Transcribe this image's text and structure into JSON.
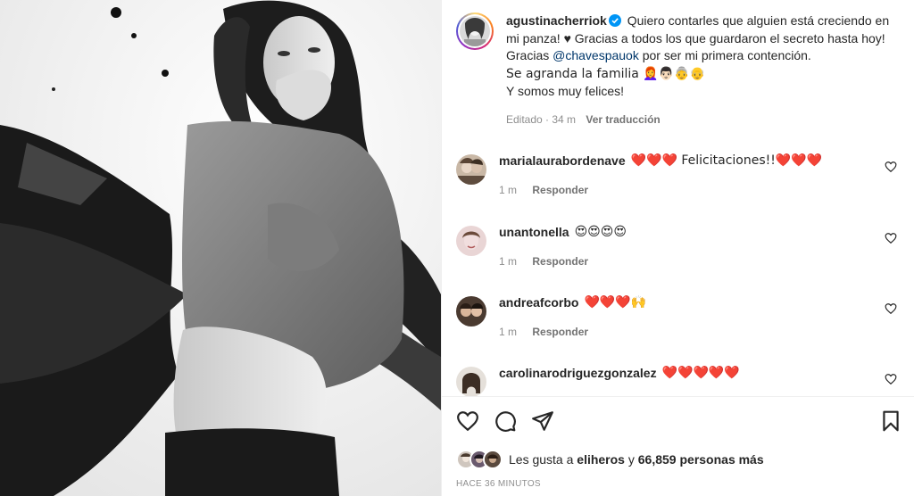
{
  "post": {
    "author": "agustinacherriok",
    "caption_line1": "Quiero contarles que alguien está creciendo en mi panza! ♥ Gracias a todos los que guardaron el secreto hasta hoy! Gracias ",
    "mention": "@chavespauok",
    "caption_line2": " por ser mi primera contención.",
    "caption_line3": "Se agranda la familia 👩‍🦰👨🏻👵👴",
    "caption_line4": "Y somos muy felices!",
    "edited_label": "Editado · 34 m",
    "translate_label": "Ver traducción"
  },
  "comments": [
    {
      "user": "marialaurabordenave",
      "text": "❤️❤️❤️ Felicitaciones!!❤️❤️❤️",
      "time": "1 m",
      "reply": "Responder"
    },
    {
      "user": "unantonella",
      "text": "😍😍😍😍",
      "time": "1 m",
      "reply": "Responder"
    },
    {
      "user": "andreafcorbo",
      "text": "❤️❤️❤️🙌",
      "time": "1 m",
      "reply": "Responder"
    },
    {
      "user": "carolinarodriguezgonzalez",
      "text": "❤️❤️❤️❤️❤️",
      "time": "",
      "reply": ""
    }
  ],
  "likes": {
    "prefix": "Les gusta a ",
    "user": "eliheros",
    "middle": " y ",
    "count_text": "66,859 personas más"
  },
  "time_ago": "HACE 36 MINUTOS",
  "icons": {
    "like": "heart-outline-icon",
    "comment": "comment-bubble-icon",
    "share": "paper-plane-icon",
    "save": "bookmark-icon",
    "verified": "verified-badge-icon"
  },
  "colors": {
    "accent": "#0095f6",
    "link": "#00376b",
    "muted": "#8e8e8e"
  }
}
